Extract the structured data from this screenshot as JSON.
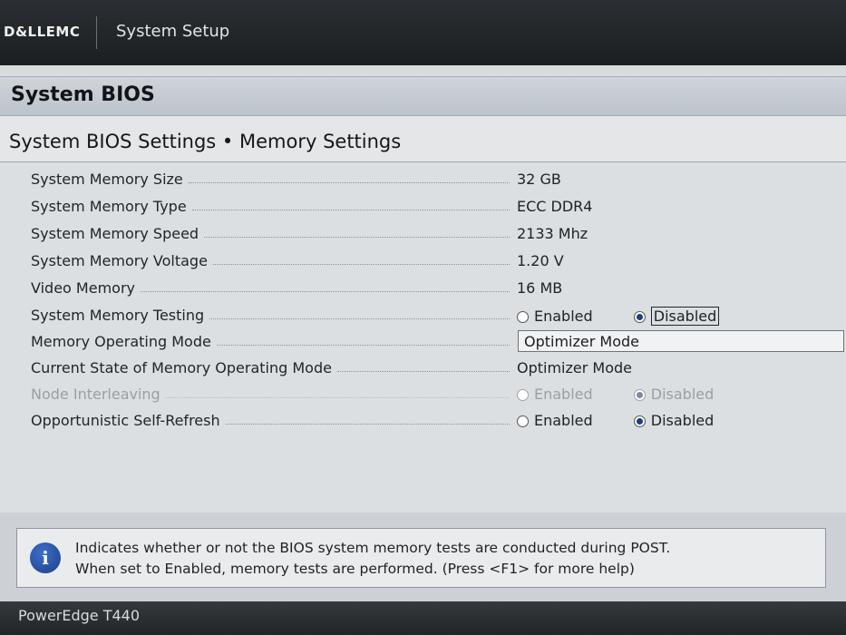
{
  "header": {
    "brand": "D&LLEMC",
    "app_title": "System Setup"
  },
  "section": {
    "title": "System BIOS"
  },
  "page": {
    "title": "System BIOS Settings • Memory Settings"
  },
  "settings": [
    {
      "label": "System Memory Size",
      "value": "32 GB"
    },
    {
      "label": "System Memory Type",
      "value": "ECC DDR4"
    },
    {
      "label": "System Memory Speed",
      "value": "2133 Mhz"
    },
    {
      "label": "System Memory Voltage",
      "value": "1.20 V"
    },
    {
      "label": "Video Memory",
      "value": "16 MB"
    },
    {
      "label": "System Memory Testing",
      "options": [
        "Enabled",
        "Disabled"
      ],
      "selected": "Disabled"
    },
    {
      "label": "Memory Operating Mode",
      "value": "Optimizer Mode"
    },
    {
      "label": "Current State of Memory Operating Mode",
      "value": "Optimizer Mode"
    },
    {
      "label": "Node Interleaving",
      "options": [
        "Enabled",
        "Disabled"
      ],
      "selected": "Disabled",
      "disabled": true
    },
    {
      "label": "Opportunistic Self-Refresh",
      "options": [
        "Enabled",
        "Disabled"
      ],
      "selected": "Disabled"
    }
  ],
  "help": {
    "icon": "info-icon",
    "line1": "Indicates whether or not the BIOS system memory tests are conducted during POST.",
    "line2": "When set to Enabled, memory tests are performed. (Press <F1> for more help)"
  },
  "footer": {
    "model": "PowerEdge T440"
  },
  "colors": {
    "header_bg": "#1b1e21",
    "section_bar": "#c4cad0",
    "panel_bg": "#dcdfe2",
    "radio_selected": "#1c3f7a"
  }
}
